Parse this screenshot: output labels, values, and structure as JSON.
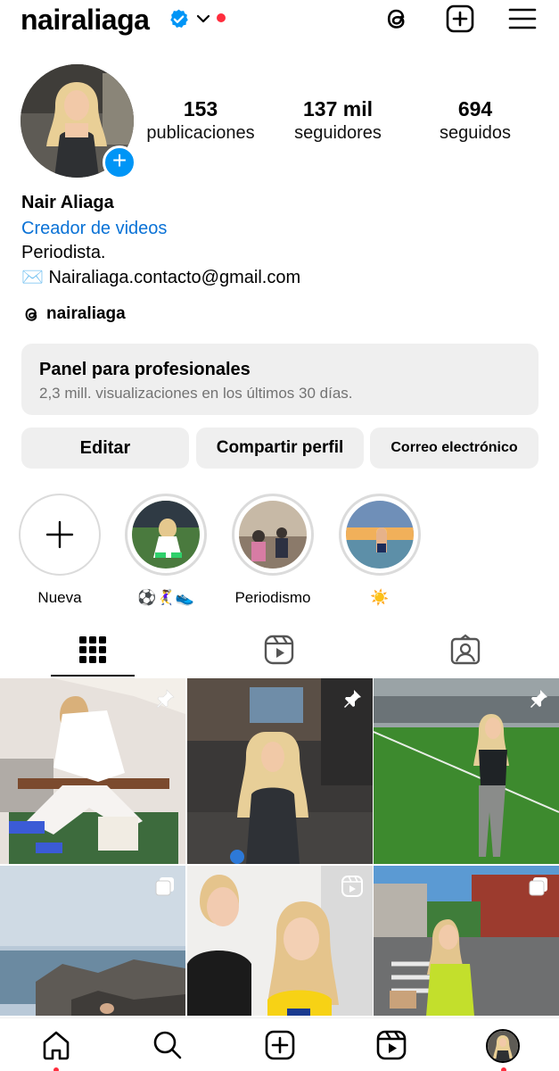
{
  "header": {
    "username": "nairaliaga",
    "icons": [
      "verified-badge-icon",
      "chevron-down-icon",
      "threads-icon",
      "create-post-icon",
      "menu-icon"
    ],
    "accent_color": "#0095f6",
    "notification_dot_color": "#ff2d3d"
  },
  "stats": [
    {
      "value": "153",
      "label": "publicaciones"
    },
    {
      "value": "137 mil",
      "label": "seguidores"
    },
    {
      "value": "694",
      "label": "seguidos"
    }
  ],
  "bio": {
    "name": "Nair Aliaga",
    "category": "Creador de videos",
    "line1": "Periodista.",
    "line2": "✉️ Nairaliaga.contacto@gmail.com",
    "threads_handle": "nairaliaga",
    "category_color": "#0a72d6"
  },
  "panel": {
    "title": "Panel para profesionales",
    "subtitle": "2,3 mill. visualizaciones en los últimos 30 días."
  },
  "buttons": {
    "edit": "Editar",
    "share": "Compartir perfil",
    "email": "Correo electrónico"
  },
  "highlights": [
    {
      "label": "Nueva"
    },
    {
      "label": "⚽️🤾‍♀️👟"
    },
    {
      "label": "Periodismo"
    },
    {
      "label": "☀️"
    }
  ],
  "tabs": [
    "grid-icon",
    "reels-icon",
    "tagged-icon"
  ],
  "grid_badges": [
    "pin-icon",
    "pin-icon",
    "pin-icon",
    "carousel-icon",
    "reel-icon",
    "carousel-icon"
  ],
  "bottom_nav": [
    "home-icon",
    "search-icon",
    "create-icon",
    "reels-icon",
    "profile-avatar"
  ]
}
